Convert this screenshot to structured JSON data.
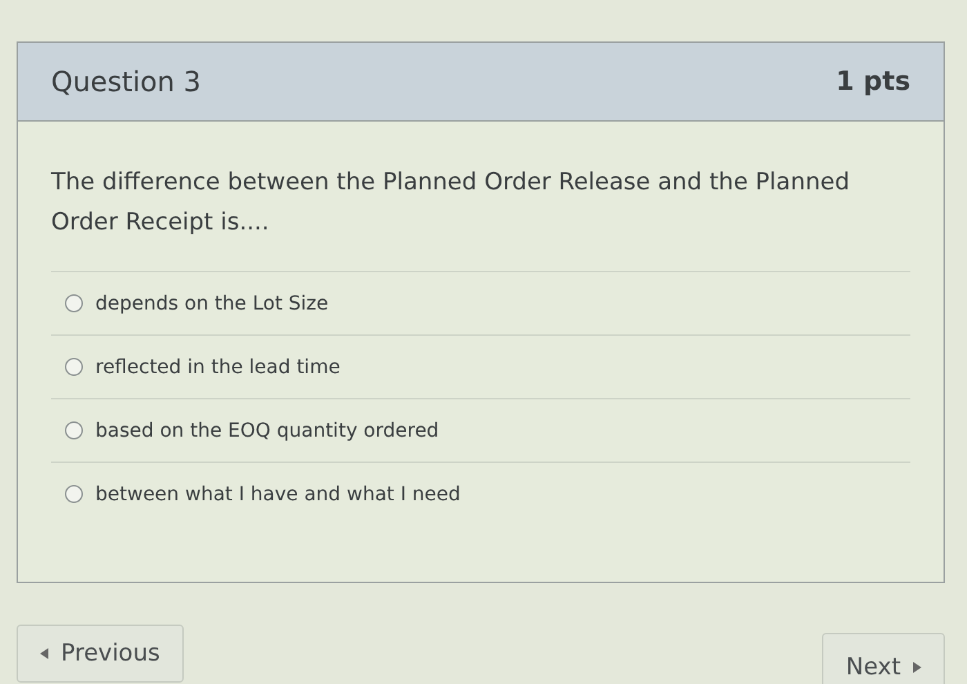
{
  "question": {
    "title": "Question 3",
    "points": "1 pts",
    "text": "The difference between the Planned Order Release and the Planned Order Receipt is...."
  },
  "answers": [
    {
      "label": "depends on the Lot Size",
      "selected": false
    },
    {
      "label": "reflected in the lead time",
      "selected": false
    },
    {
      "label": "based on the EOQ quantity ordered",
      "selected": false
    },
    {
      "label": "between what I have and what I need",
      "selected": false
    }
  ],
  "nav": {
    "previous": "Previous",
    "next": "Next"
  }
}
